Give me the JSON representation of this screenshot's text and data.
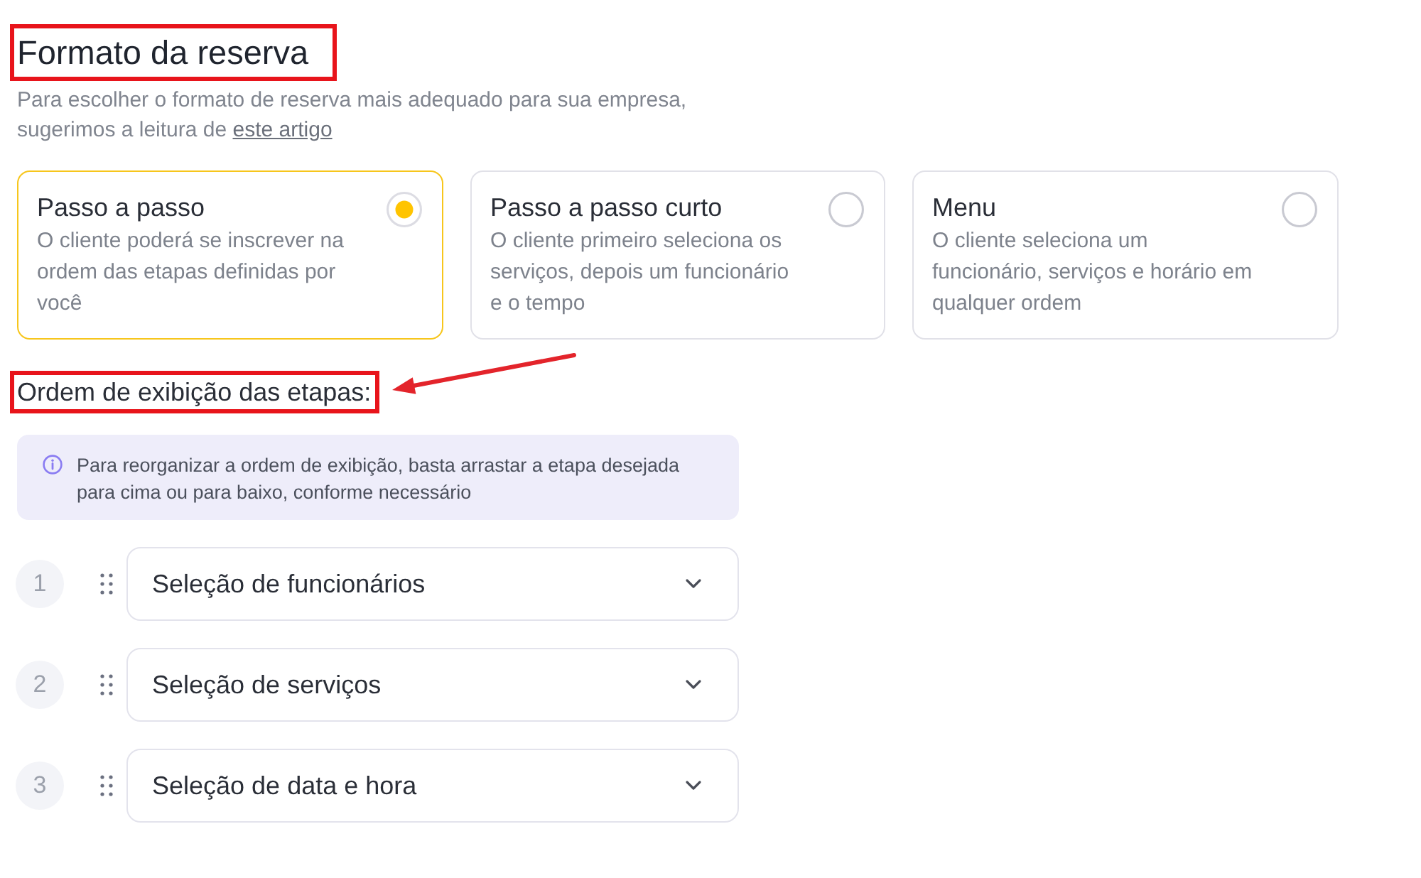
{
  "title": {
    "text": "Formato da reserva",
    "highlighted": true
  },
  "intro": {
    "text": "Para escolher o formato de reserva mais adequado para sua empresa, sugerimos a leitura de",
    "link": "este artigo"
  },
  "formats": [
    {
      "title": "Passo a passo",
      "description": "O cliente poderá se inscrever na ordem das etapas definidas por você",
      "selected": true
    },
    {
      "title": "Passo a passo curto",
      "description": "O cliente primeiro seleciona os serviços, depois um funcionário e o tempo",
      "selected": false
    },
    {
      "title": "Menu",
      "description": "O cliente seleciona um funcionário, serviços e horário em qualquer ordem",
      "selected": false
    }
  ],
  "steps_heading": {
    "text": "Ordem de exibição das etapas:",
    "highlighted": true,
    "arrow": true
  },
  "info": {
    "text": "Para reorganizar a ordem de exibição, basta arrastar a etapa desejada para cima ou para baixo, conforme necessário"
  },
  "steps": [
    {
      "number": "1",
      "label": "Seleção de funcionários"
    },
    {
      "number": "2",
      "label": "Seleção de serviços"
    },
    {
      "number": "3",
      "label": "Seleção de data e hora"
    }
  ]
}
